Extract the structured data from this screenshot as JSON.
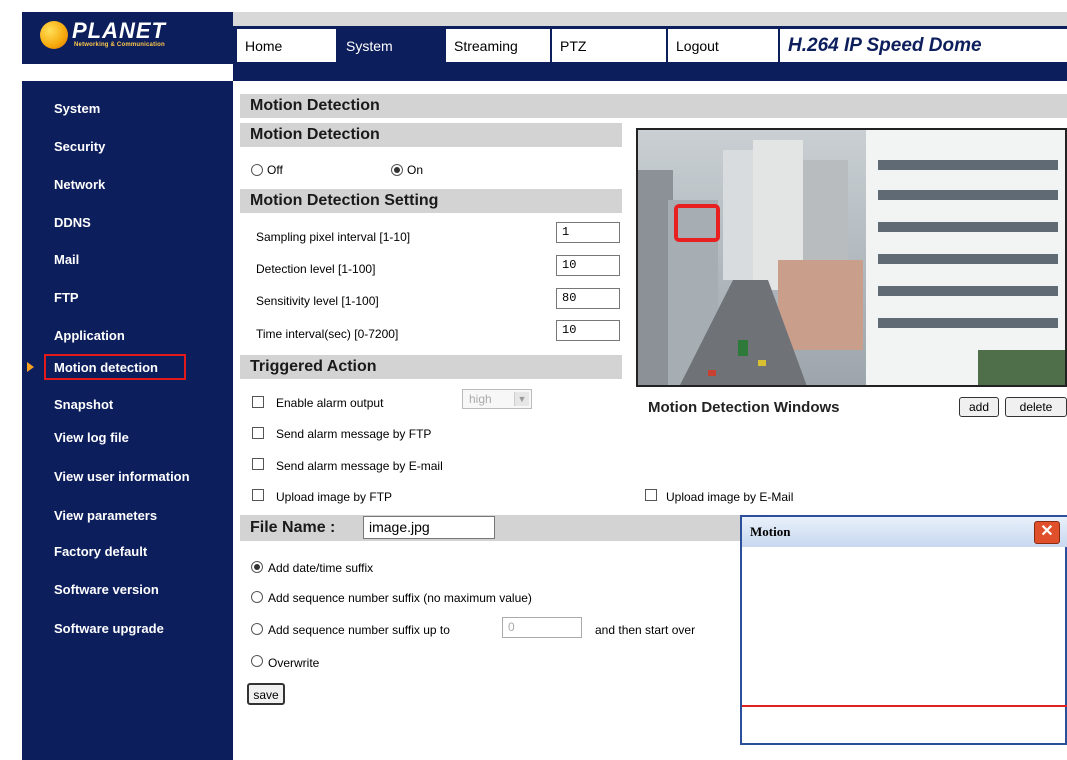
{
  "brand": {
    "logo_text": "PLANET",
    "logo_sub": "Networking & Communication",
    "product": "H.264 IP Speed Dome"
  },
  "nav": {
    "tabs": [
      {
        "label": "Home"
      },
      {
        "label": "System"
      },
      {
        "label": "Streaming"
      },
      {
        "label": "PTZ"
      },
      {
        "label": "Logout"
      }
    ],
    "active_tab": "System"
  },
  "sidebar": {
    "items": [
      {
        "label": "System"
      },
      {
        "label": "Security"
      },
      {
        "label": "Network"
      },
      {
        "label": "DDNS"
      },
      {
        "label": "Mail"
      },
      {
        "label": "FTP"
      },
      {
        "label": "Application"
      },
      {
        "label": "Motion detection"
      },
      {
        "label": "Snapshot"
      },
      {
        "label": "View log file"
      },
      {
        "label": "View user information"
      },
      {
        "label": "View parameters"
      },
      {
        "label": "Factory default"
      },
      {
        "label": "Software version"
      },
      {
        "label": "Software upgrade"
      }
    ],
    "active": "Motion detection"
  },
  "page": {
    "title": "Motion Detection",
    "section_md": "Motion Detection",
    "off_label": "Off",
    "on_label": "On",
    "md_selected": "On",
    "section_setting": "Motion Detection Setting",
    "settings": [
      {
        "label": "Sampling pixel interval [1-10]",
        "value": "1"
      },
      {
        "label": "Detection level [1-100]",
        "value": "10"
      },
      {
        "label": "Sensitivity level [1-100]",
        "value": "80"
      },
      {
        "label": "Time interval(sec) [0-7200]",
        "value": "10"
      }
    ],
    "section_triggered": "Triggered Action",
    "enable_alarm_label": "Enable alarm output",
    "alarm_level": "high",
    "ftp_msg_label": "Send alarm message by FTP",
    "email_msg_label": "Send alarm message by E-mail",
    "upload_ftp_label": "Upload image by FTP",
    "upload_email_label": "Upload image by E-Mail",
    "windows_title": "Motion Detection Windows",
    "add_label": "add",
    "delete_label": "delete",
    "file_name_label": "File Name :",
    "file_name_value": "image.jpg",
    "suffix_date": "Add date/time suffix",
    "suffix_seq": "Add sequence number suffix (no maximum value)",
    "suffix_seq_up": "Add sequence number suffix up to",
    "suffix_seq_up_value": "0",
    "suffix_seq_after": "and then start over",
    "overwrite": "Overwrite",
    "save_label": "save",
    "motion_window_title": "Motion"
  },
  "colors": {
    "navy": "#0d1e5c",
    "header_gray": "#d3d3d3",
    "alert_red": "#e21a1a",
    "arrow_orange": "#f7a020"
  }
}
